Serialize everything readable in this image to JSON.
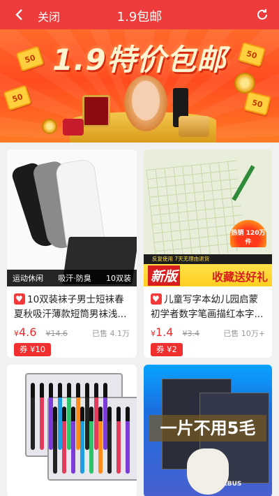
{
  "header": {
    "close_label": "关闭",
    "title": "1.9包邮"
  },
  "banner": {
    "title": "1.9特价包邮",
    "coupon_text": "50"
  },
  "products": [
    {
      "title": "10双装袜子男士短袜春夏秋吸汗薄款短筒男袜浅...",
      "price_symbol": "¥",
      "price": "4.6",
      "old_price": "¥14.6",
      "sold": "已售 4.1万",
      "coupon": "券 ¥10",
      "image_caption_left": "运动休闲",
      "image_caption_mid": "吸汗·防臭",
      "image_caption_right": "10双装"
    },
    {
      "title": "儿童写字本幼儿园启蒙初学者数字笔画描红本字...",
      "price_symbol": "¥",
      "price": "1.4",
      "old_price": "¥3.4",
      "sold": "已售 10万+",
      "coupon": "券 ¥2",
      "image_badge": "新版",
      "image_slogan": "收藏送好礼",
      "image_strip": "反复使用  7天无理由退货",
      "image_hot": "热销 120万件"
    },
    {
      "title": "",
      "image_label": "牙刷"
    },
    {
      "title": "",
      "image_slogan": "一片不用5毛",
      "image_brand": "LBUS"
    }
  ]
}
